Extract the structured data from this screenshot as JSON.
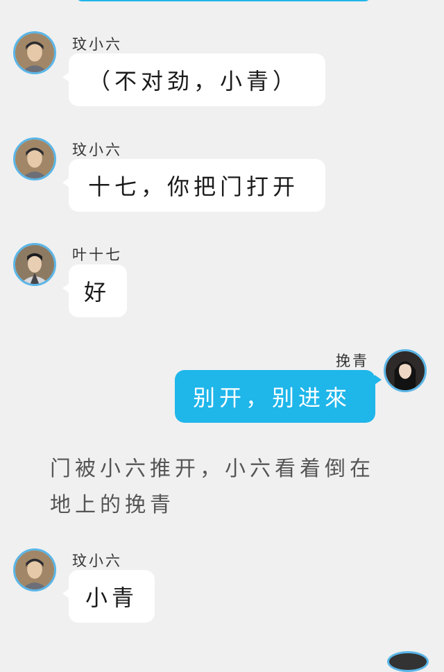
{
  "messages": [
    {
      "sender": "玟小六",
      "text": "（不对劲，小青）",
      "side": "left",
      "avatar_icon": "avatar-woman-headscarf-icon"
    },
    {
      "sender": "玟小六",
      "text": "十七，你把门打开",
      "side": "left",
      "avatar_icon": "avatar-woman-headscarf-icon"
    },
    {
      "sender": "叶十七",
      "text": "好",
      "side": "left",
      "avatar_icon": "avatar-man-dark-hair-icon"
    },
    {
      "sender": "挽青",
      "text": "别开，别进來",
      "side": "right",
      "avatar_icon": "avatar-woman-long-hair-icon"
    },
    {
      "sender": "玟小六",
      "text": "小青",
      "side": "left",
      "avatar_icon": "avatar-woman-headscarf-icon"
    }
  ],
  "narration": "门被小六推开，小六看着倒在地上的挽青",
  "colors": {
    "background": "#f0f0f0",
    "received_bubble": "#ffffff",
    "sent_bubble": "#1fb6ea",
    "avatar_ring": "#5ab6e8"
  }
}
